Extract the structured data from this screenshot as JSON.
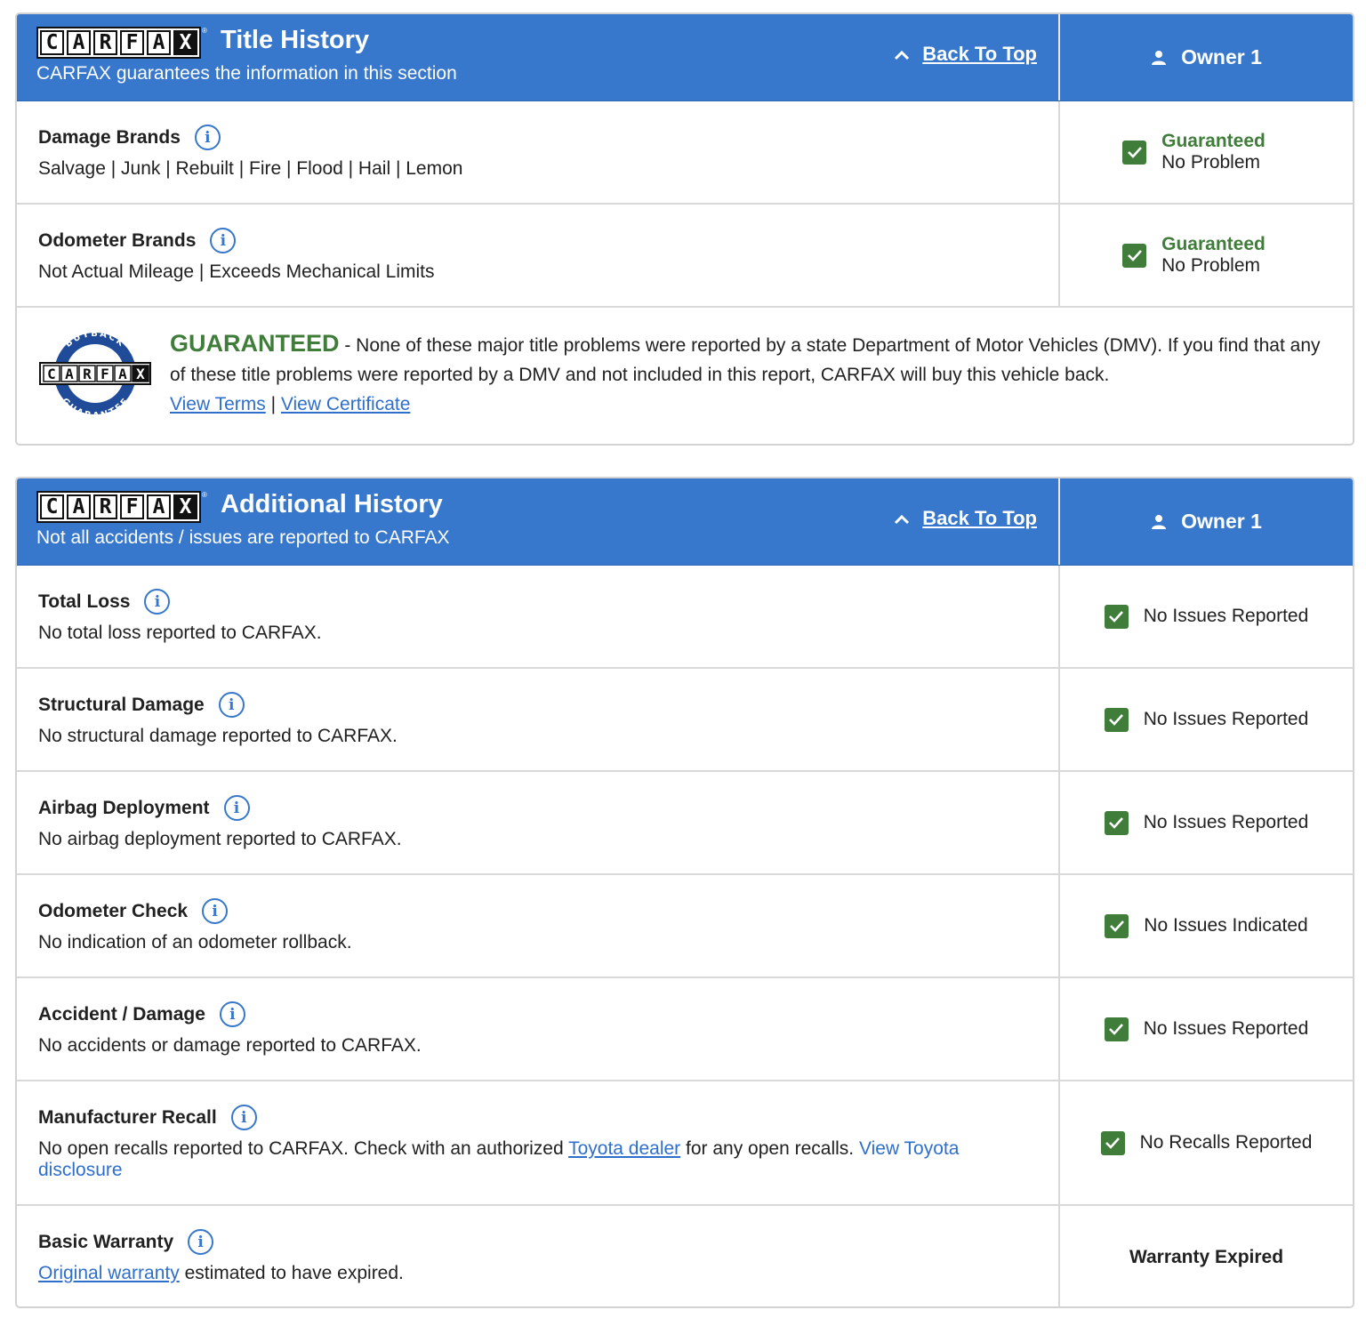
{
  "title_history": {
    "logo_letters": [
      "C",
      "A",
      "R",
      "F",
      "A",
      "X"
    ],
    "title": "Title History",
    "subtitle": "CARFAX guarantees the information in this section",
    "back_to_top": "Back To Top",
    "owner": "Owner 1",
    "rows": [
      {
        "label": "Damage Brands",
        "description": "Salvage | Junk | Rebuilt | Fire | Flood | Hail | Lemon",
        "status_title": "Guaranteed",
        "status": "No Problem"
      },
      {
        "label": "Odometer Brands",
        "description": "Not Actual Mileage | Exceeds Mechanical Limits",
        "status_title": "Guaranteed",
        "status": "No Problem"
      }
    ],
    "guarantee": {
      "seal_top": "BUYBACK",
      "seal_bottom": "GUARANTEE",
      "heading": "GUARANTEED",
      "text": " - None of these major title problems were reported by a state Department of Motor Vehicles (DMV). If you find that any of these title problems were reported by a DMV and not included in this report, CARFAX will buy this vehicle back.",
      "link_terms": "View Terms",
      "separator": " | ",
      "link_certificate": "View Certificate"
    }
  },
  "additional_history": {
    "logo_letters": [
      "C",
      "A",
      "R",
      "F",
      "A",
      "X"
    ],
    "title": "Additional History",
    "subtitle": "Not all accidents / issues are reported to CARFAX",
    "back_to_top": "Back To Top",
    "owner": "Owner 1",
    "rows": [
      {
        "label": "Total Loss",
        "description": "No total loss reported to CARFAX.",
        "status": "No Issues Reported"
      },
      {
        "label": "Structural Damage",
        "description": "No structural damage reported to CARFAX.",
        "status": "No Issues Reported"
      },
      {
        "label": "Airbag Deployment",
        "description": "No airbag deployment reported to CARFAX.",
        "status": "No Issues Reported"
      },
      {
        "label": "Odometer Check",
        "description": "No indication of an odometer rollback.",
        "status": "No Issues Indicated"
      },
      {
        "label": "Accident / Damage",
        "description": "No accidents or damage reported to CARFAX.",
        "status": "No Issues Reported"
      }
    ],
    "recall": {
      "label": "Manufacturer Recall",
      "text_before": "No open recalls reported to CARFAX. Check with an authorized ",
      "link_dealer": "Toyota dealer",
      "text_middle": " for any open recalls. ",
      "link_disclosure": "View Toyota disclosure",
      "status": "No Recalls Reported"
    },
    "warranty": {
      "label": "Basic Warranty",
      "link": "Original warranty",
      "text_after": " estimated to have expired.",
      "status": "Warranty Expired"
    }
  },
  "colors": {
    "header_blue": "#3777cc",
    "link_blue": "#2f6fcc",
    "guaranteed_green": "#417d3a"
  }
}
